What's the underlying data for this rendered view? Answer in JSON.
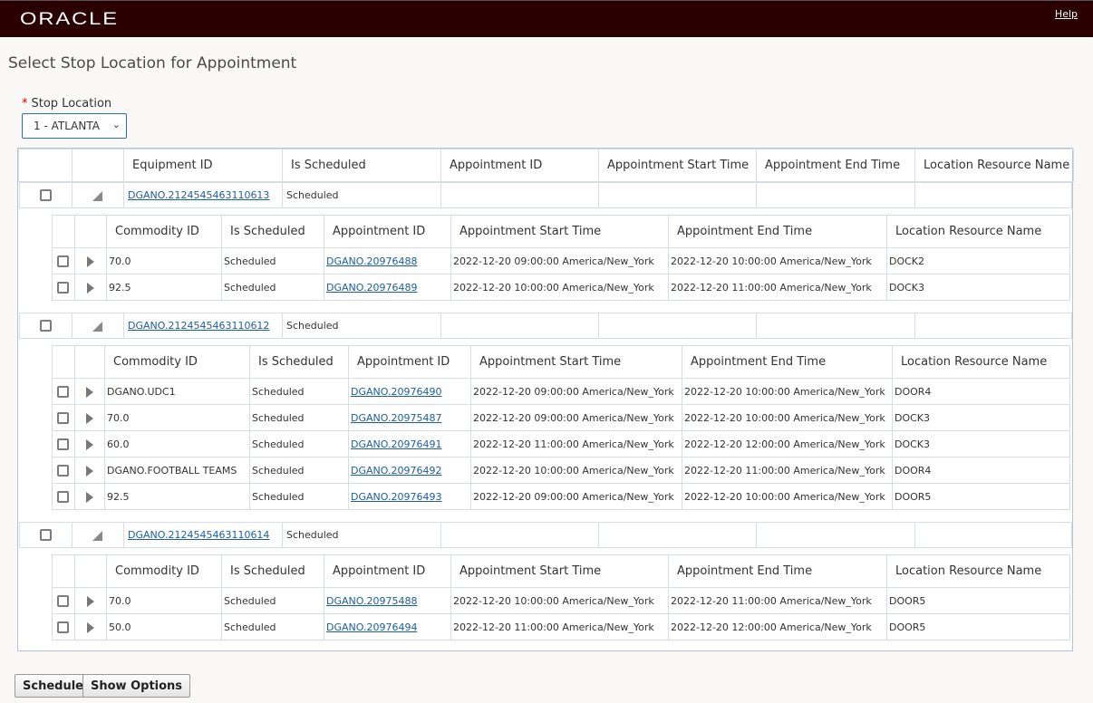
{
  "header": {
    "logo": "ORACLE",
    "help": "Help"
  },
  "page_title": "Select Stop Location for Appointment",
  "stop_location": {
    "label": "Stop Location",
    "required_marker": "*",
    "value": "1 - ATLANTA"
  },
  "outer_columns": [
    "",
    "",
    "Equipment ID",
    "Is Scheduled",
    "Appointment ID",
    "Appointment Start Time",
    "Appointment End Time",
    "Location Resource Name"
  ],
  "nested_columns": [
    "",
    "",
    "Commodity ID",
    "Is Scheduled",
    "Appointment ID",
    "Appointment Start Time",
    "Appointment End Time",
    "Location Resource Name"
  ],
  "groups": [
    {
      "equipment_id": "DGANO.2124545463110613",
      "is_scheduled": "Scheduled",
      "expanded": true,
      "rows": [
        {
          "commodity": "70.0",
          "scheduled": "Scheduled",
          "appt": "DGANO.20976488",
          "start": "2022-12-20 09:00:00 America/New_York",
          "end": "2022-12-20 10:00:00 America/New_York",
          "resource": "DOCK2"
        },
        {
          "commodity": "92.5",
          "scheduled": "Scheduled",
          "appt": "DGANO.20976489",
          "start": "2022-12-20 10:00:00 America/New_York",
          "end": "2022-12-20 11:00:00 America/New_York",
          "resource": "DOCK3"
        }
      ]
    },
    {
      "equipment_id": "DGANO.2124545463110612",
      "is_scheduled": "Scheduled",
      "expanded": true,
      "rows": [
        {
          "commodity": "DGANO.UDC1",
          "scheduled": "Scheduled",
          "appt": "DGANO.20976490",
          "start": "2022-12-20 09:00:00 America/New_York",
          "end": "2022-12-20 10:00:00 America/New_York",
          "resource": "DOOR4"
        },
        {
          "commodity": "70.0",
          "scheduled": "Scheduled",
          "appt": "DGANO.20975487",
          "start": "2022-12-20 09:00:00 America/New_York",
          "end": "2022-12-20 10:00:00 America/New_York",
          "resource": "DOCK3"
        },
        {
          "commodity": "60.0",
          "scheduled": "Scheduled",
          "appt": "DGANO.20976491",
          "start": "2022-12-20 11:00:00 America/New_York",
          "end": "2022-12-20 12:00:00 America/New_York",
          "resource": "DOCK3"
        },
        {
          "commodity": "DGANO.FOOTBALL TEAMS",
          "scheduled": "Scheduled",
          "appt": "DGANO.20976492",
          "start": "2022-12-20 10:00:00 America/New_York",
          "end": "2022-12-20 11:00:00 America/New_York",
          "resource": "DOOR4"
        },
        {
          "commodity": "92.5",
          "scheduled": "Scheduled",
          "appt": "DGANO.20976493",
          "start": "2022-12-20 09:00:00 America/New_York",
          "end": "2022-12-20 10:00:00 America/New_York",
          "resource": "DOOR5"
        }
      ]
    },
    {
      "equipment_id": "DGANO.2124545463110614",
      "is_scheduled": "Scheduled",
      "expanded": true,
      "rows": [
        {
          "commodity": "70.0",
          "scheduled": "Scheduled",
          "appt": "DGANO.20975488",
          "start": "2022-12-20 10:00:00 America/New_York",
          "end": "2022-12-20 11:00:00 America/New_York",
          "resource": "DOOR5"
        },
        {
          "commodity": "50.0",
          "scheduled": "Scheduled",
          "appt": "DGANO.20976494",
          "start": "2022-12-20 11:00:00 America/New_York",
          "end": "2022-12-20 12:00:00 America/New_York",
          "resource": "DOOR5"
        }
      ]
    }
  ],
  "buttons": {
    "schedule": "Schedule",
    "show_options": "Show Options"
  }
}
